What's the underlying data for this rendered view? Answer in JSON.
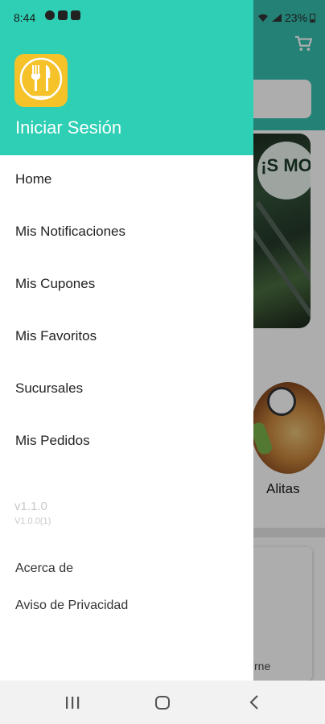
{
  "status_bar": {
    "time": "8:44",
    "battery": "23%",
    "left_icons": [
      "a-icon",
      "image-icon",
      "doc-icon"
    ]
  },
  "drawer": {
    "title": "Iniciar Sesión",
    "header_color": "#2ecfb4",
    "logo_color": "#f5c22a",
    "menu": [
      {
        "label": "Home",
        "icon": "none"
      },
      {
        "label": "Mis Notificaciones",
        "icon": "none"
      },
      {
        "label": "Mis Cupones",
        "icon": "none"
      },
      {
        "label": "Mis Favoritos",
        "icon": "none"
      },
      {
        "label": "Sucursales",
        "icon": "none"
      },
      {
        "label": "Mis Pedidos",
        "icon": "none"
      }
    ],
    "version": "v1.1.0",
    "version_build": "V1.0.0(1)",
    "links": [
      "Acerca de",
      "Aviso de Privacidad"
    ]
  },
  "background_app": {
    "header_color": "#36bfae",
    "banner_text": "¡S MO",
    "category_label": "Alitas",
    "card_text": "rne"
  },
  "navbar": {
    "buttons": [
      "recents-icon",
      "home-icon",
      "back-icon"
    ]
  }
}
